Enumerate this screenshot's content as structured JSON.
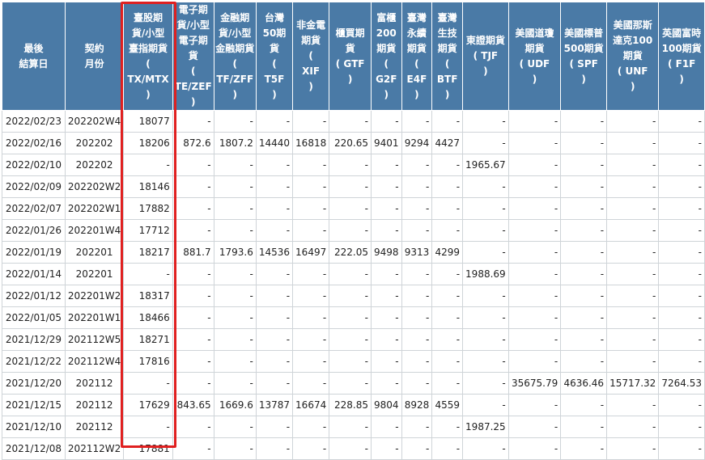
{
  "highlight_color": "#e02020",
  "header_color": "#4a7aa6",
  "columns": [
    {
      "label": "最後\n結算日"
    },
    {
      "label": "契約\n月份"
    },
    {
      "label": "臺股期\n貨/小型\n臺指期貨\n(\nTX/MTX\n)"
    },
    {
      "label": "電子期\n貨/小型\n電子期貨\n(\nTE/ZEF\n)"
    },
    {
      "label": "金融期\n貨/小型\n金融期貨\n(\nTF/ZFF\n)"
    },
    {
      "label": "台灣\n50期\n貨\n(\nT5F\n)"
    },
    {
      "label": "非金電\n期貨\n(\nXIF\n)"
    },
    {
      "label": "櫃買期\n貨\n( GTF\n)"
    },
    {
      "label": "富櫃\n200\n期貨\n(\nG2F\n)"
    },
    {
      "label": "臺灣\n永續\n期貨\n(\nE4F\n)"
    },
    {
      "label": "臺灣\n生技\n期貨\n(\nBTF\n)"
    },
    {
      "label": "東證期貨\n( TJF\n)"
    },
    {
      "label": "美國道瓊\n期貨\n( UDF\n)"
    },
    {
      "label": "美國標普\n500期貨\n( SPF\n)"
    },
    {
      "label": "美國那斯\n達克100\n期貨\n( UNF\n)"
    },
    {
      "label": "英國富時\n100期貨\n( F1F\n)"
    }
  ],
  "rows": [
    [
      "2022/02/23",
      "202202W4",
      "18077",
      "-",
      "-",
      "-",
      "-",
      "-",
      "-",
      "-",
      "-",
      "-",
      "-",
      "-",
      "-",
      "-"
    ],
    [
      "2022/02/16",
      "202202",
      "18206",
      "872.6",
      "1807.2",
      "14440",
      "16818",
      "220.65",
      "9401",
      "9294",
      "4427",
      "-",
      "-",
      "-",
      "-",
      "-"
    ],
    [
      "2022/02/10",
      "202202",
      "-",
      "-",
      "-",
      "-",
      "-",
      "-",
      "-",
      "-",
      "-",
      "1965.67",
      "-",
      "-",
      "-",
      "-"
    ],
    [
      "2022/02/09",
      "202202W2",
      "18146",
      "-",
      "-",
      "-",
      "-",
      "-",
      "-",
      "-",
      "-",
      "-",
      "-",
      "-",
      "-",
      "-"
    ],
    [
      "2022/02/07",
      "202202W1",
      "17882",
      "-",
      "-",
      "-",
      "-",
      "-",
      "-",
      "-",
      "-",
      "-",
      "-",
      "-",
      "-",
      "-"
    ],
    [
      "2022/01/26",
      "202201W4",
      "17712",
      "-",
      "-",
      "-",
      "-",
      "-",
      "-",
      "-",
      "-",
      "-",
      "-",
      "-",
      "-",
      "-"
    ],
    [
      "2022/01/19",
      "202201",
      "18217",
      "881.7",
      "1793.6",
      "14536",
      "16497",
      "222.05",
      "9498",
      "9313",
      "4299",
      "-",
      "-",
      "-",
      "-",
      "-"
    ],
    [
      "2022/01/14",
      "202201",
      "-",
      "-",
      "-",
      "-",
      "-",
      "-",
      "-",
      "-",
      "-",
      "1988.69",
      "-",
      "-",
      "-",
      "-"
    ],
    [
      "2022/01/12",
      "202201W2",
      "18317",
      "-",
      "-",
      "-",
      "-",
      "-",
      "-",
      "-",
      "-",
      "-",
      "-",
      "-",
      "-",
      "-"
    ],
    [
      "2022/01/05",
      "202201W1",
      "18466",
      "-",
      "-",
      "-",
      "-",
      "-",
      "-",
      "-",
      "-",
      "-",
      "-",
      "-",
      "-",
      "-"
    ],
    [
      "2021/12/29",
      "202112W5",
      "18271",
      "-",
      "-",
      "-",
      "-",
      "-",
      "-",
      "-",
      "-",
      "-",
      "-",
      "-",
      "-",
      "-"
    ],
    [
      "2021/12/22",
      "202112W4",
      "17816",
      "-",
      "-",
      "-",
      "-",
      "-",
      "-",
      "-",
      "-",
      "-",
      "-",
      "-",
      "-",
      "-"
    ],
    [
      "2021/12/20",
      "202112",
      "-",
      "-",
      "-",
      "-",
      "-",
      "-",
      "-",
      "-",
      "-",
      "-",
      "35675.79",
      "4636.46",
      "15717.32",
      "7264.53"
    ],
    [
      "2021/12/15",
      "202112",
      "17629",
      "843.65",
      "1669.6",
      "13787",
      "16674",
      "228.85",
      "9804",
      "8928",
      "4559",
      "-",
      "-",
      "-",
      "-",
      "-"
    ],
    [
      "2021/12/10",
      "202112",
      "-",
      "-",
      "-",
      "-",
      "-",
      "-",
      "-",
      "-",
      "-",
      "1987.25",
      "-",
      "-",
      "-",
      "-"
    ],
    [
      "2021/12/08",
      "202112W2",
      "17881",
      "-",
      "-",
      "-",
      "-",
      "-",
      "-",
      "-",
      "-",
      "-",
      "-",
      "-",
      "-",
      "-"
    ]
  ]
}
